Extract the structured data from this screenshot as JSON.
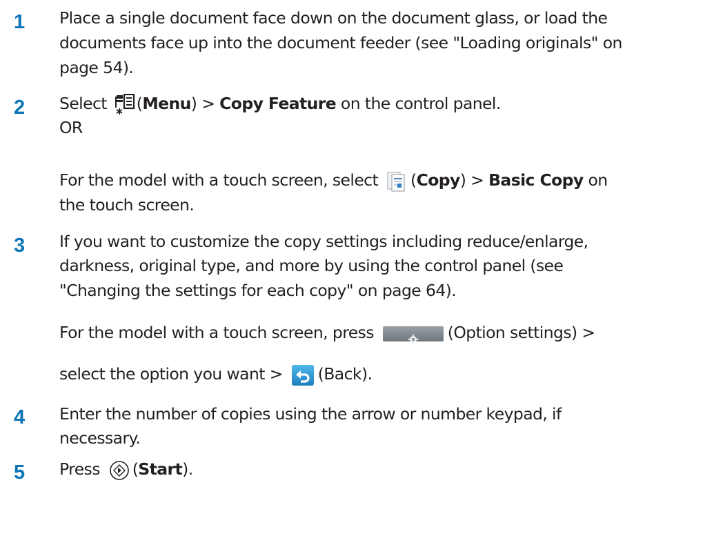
{
  "steps": [
    {
      "number": "1",
      "lines": [
        "Place a single document face down on the document glass, or load the",
        "documents face up into the document feeder (see \"Loading originals\" on",
        "page 54)."
      ]
    },
    {
      "number": "2",
      "line1": {
        "pre": "Select ",
        "open": "(",
        "menu": "Menu",
        "mid": ") > ",
        "feature": "Copy Feature",
        "post": " on the control panel."
      },
      "or": "OR",
      "line3": {
        "pre": "For the model with a touch screen, select ",
        "open": "(",
        "copy": "Copy",
        "mid": ") > ",
        "basic": "Basic Copy",
        "post": "  on"
      },
      "line4": "the touch screen."
    },
    {
      "number": "3",
      "lines": [
        "If you want to customize the copy settings including reduce/enlarge,",
        "darkness, original type, and more by using the control panel (see",
        "\"Changing the settings for each copy\" on page 64)."
      ],
      "line4": {
        "pre": "For the model with a touch screen, press ",
        "post": "(Option settings) >"
      },
      "line5": {
        "pre": "select the option you want > ",
        "post": "(Back)."
      }
    },
    {
      "number": "4",
      "lines": [
        "Enter the number of copies using the arrow or number keypad, if",
        "necessary."
      ]
    },
    {
      "number": "5",
      "line1": {
        "pre": "Press ",
        "open": "(",
        "start": "Start",
        "post": ")."
      }
    }
  ],
  "icons": {
    "menu": "menu-icon",
    "copy": "copy-icon",
    "options": "gear-icon",
    "back": "back-arrow-icon",
    "start": "start-icon"
  },
  "colors": {
    "step_number": "#0b75b8",
    "text": "#231f20"
  }
}
